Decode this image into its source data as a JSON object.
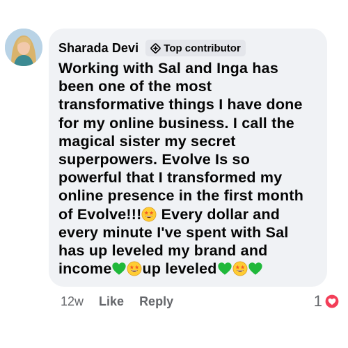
{
  "comment": {
    "author": "Sharada Devi",
    "badge": "Top contributor",
    "lines": [
      "Working with Sal and Inga has",
      "been one of the most",
      "transformative things I have done",
      "for my online business.  I call the",
      "magical sister my secret",
      "superpowers.   Evolve Is so",
      "powerful that I transformed my",
      "online presence in the first month",
      "of Evolve!!!",
      " Every dollar and",
      "every minute I've spent with Sal",
      "has up leveled my brand and",
      "income",
      "up leveled"
    ],
    "emojis": [
      "star-struck-emoji",
      "green-heart-emoji"
    ],
    "colors": {
      "heart": "#1fb83a",
      "love_reaction": "#f33e58",
      "bubble": "#f0f2f5"
    }
  },
  "actions": {
    "age": "12w",
    "like": "Like",
    "reply": "Reply"
  },
  "reactions": {
    "count": "1",
    "icon": "heart-reaction-icon"
  }
}
